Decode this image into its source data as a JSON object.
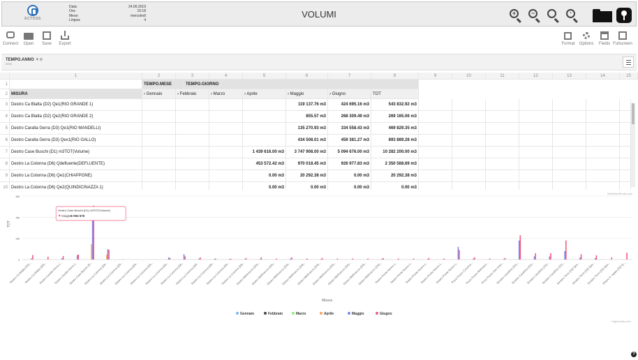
{
  "header": {
    "logo_text": "ECTOSS",
    "meta": [
      {
        "label": "Data:",
        "value": "24.06.2019"
      },
      {
        "label": "Ora:",
        "value": "10:18"
      },
      {
        "label": "Mese:",
        "value": "mercoledì"
      },
      {
        "label": "Lingua:",
        "value": "it"
      }
    ],
    "title": "VOLUMI"
  },
  "toolbar": {
    "left": [
      {
        "label": "Connect",
        "icon": "database-icon"
      },
      {
        "label": "Open",
        "icon": "folder-icon"
      },
      {
        "label": "Save",
        "icon": "save-icon"
      },
      {
        "label": "Export",
        "icon": "export-icon"
      }
    ],
    "right": [
      {
        "label": "Format",
        "icon": "edit-icon"
      },
      {
        "label": "Options",
        "icon": "gear-icon"
      },
      {
        "label": "Fields",
        "icon": "fields-icon"
      },
      {
        "label": "Fullscreen",
        "icon": "fullscreen-icon"
      }
    ]
  },
  "filter": {
    "chip_label": "TEMPO.ANNO",
    "chip_value": "2019"
  },
  "grid": {
    "col_headers": [
      "1",
      "2",
      "3",
      "4",
      "5",
      "6",
      "7",
      "8",
      "9",
      "10",
      "11",
      "12",
      "13",
      "14",
      "15"
    ],
    "dim_headers": [
      "TEMPO.MESE",
      "TEMPO.GIORNO"
    ],
    "row_header_label": "MISURA",
    "months": [
      "Gennaio",
      "Febbraio",
      "Marzo",
      "Aprile",
      "Maggio",
      "Giugno",
      "TOT"
    ],
    "rows": [
      {
        "n": "3",
        "name": "Destro Ca Blatta (D2) Qe1(RIO GRANDE 1)",
        "v": [
          "",
          "",
          "",
          "",
          "119 137.76 m3",
          "424 695.16 m3",
          "543 832.92 m3"
        ]
      },
      {
        "n": "4",
        "name": "Destro Ca Blatta (D2) Qe2(RIO GRANDE 2)",
        "v": [
          "",
          "",
          "",
          "",
          "855.57 m3",
          "268 309.49 m3",
          "269 165.06 m3"
        ]
      },
      {
        "n": "5",
        "name": "Destro Caralta Gerra (D3) Qe1(RIO MANDELLI)",
        "v": [
          "",
          "",
          "",
          "",
          "135 270.93 m3",
          "334 558.43 m3",
          "469 829.35 m3"
        ]
      },
      {
        "n": "6",
        "name": "Destro Caralta Gerra (D3) Qex1(RIO GALLO)",
        "v": [
          "",
          "",
          "",
          "",
          "434 508.01 m3",
          "459 381.27 m3",
          "893 889.28 m3"
        ]
      },
      {
        "n": "7",
        "name": "Destro Case Buschi (D1) m3TOT(Volume)",
        "v": [
          "",
          "",
          "",
          "1 439 616.00 m3",
          "3 747 908.00 m3",
          "5 094 676.00 m3",
          "10 282 200.00 m3"
        ]
      },
      {
        "n": "8",
        "name": "Destro La Colonna (D6) Qdefluente(DEFLUENTE)",
        "v": [
          "",
          "",
          "",
          "453 572.42 m3",
          "970 018.45 m3",
          "926 977.83 m3",
          "2 350 568.69 m3"
        ]
      },
      {
        "n": "9",
        "name": "Destro La Colonna (D6) Qe1(CHIAPPONE)",
        "v": [
          "",
          "",
          "",
          "0.00 m3",
          "20 292.38 m3",
          "0.00 m3",
          "20 292.38 m3"
        ]
      },
      {
        "n": "10",
        "name": "Destro La Colonna (D6) Qe2(QUINDICINAZZA 1)",
        "v": [
          "",
          "",
          "",
          "0.00 m3",
          "0.00 m3",
          "0.00 m3",
          "0.00 m3"
        ]
      }
    ],
    "credit": "WebDataRocks.com"
  },
  "chart_data": {
    "type": "bar",
    "ylabel": "TOT",
    "xlabel": "Misura",
    "y_ticks": [
      "6M",
      "4M",
      "2M",
      "0"
    ],
    "ylim": [
      0,
      6000000
    ],
    "categories": [
      "Destro Ca Blatta (D2)...",
      "Destro Ca Blatta (D2)...",
      "Destro Caralta Gerra (...",
      "Destro Caralta Gerra (...",
      "Destro Case Buschi (D...",
      "Destro La Colonna (D6...",
      "Destro La Colonna (D6...",
      "Destro La Colonna (D6...",
      "Destro La Colonna (D6...",
      "Destro La Colonna (D6...",
      "Destro La Colonna (D6...",
      "Destro La Colonna (D6...",
      "Destro La Colonna (D6...",
      "Destro La Colonna (D6...",
      "Destro La Colonna (D6...",
      "Destro Mellinaccio (D4)...",
      "Destro Mellinaccio (D4)...",
      "Destro Mellinaccio (D4)...",
      "Destro Mellinaccio (D4)...",
      "Destro Mellinaccio (D4)...",
      "Destro Mellinaccio (D4)...",
      "Destro Mellinaccio (D4)...",
      "Destro Mellinaccio (D4)...",
      "Destro Mellinaccio (D4)...",
      "Destro Ponte Nuovo (...",
      "Destro Ponte Nuovo (...",
      "Destro Ponte Nuovo (...",
      "Destro Ponte Nuovo (...",
      "Destro Ponte Nuovo (...",
      "Pozzi Pozzo Coriomo...",
      "Pozzi Pozzo Molinazzi...",
      "Pozzi Pozzo San Anto...",
      "Sinistro Cavalline (S1)...",
      "Sinistro Cavalline (S1)...",
      "Sinistro Cavalline (S1)...",
      "Sinistro Cavalline (S1)...",
      "Sinistro Torre (S3) Qe1...",
      "Sinistro Torre (S3) Qex...",
      "Sinistro Torre (S3) Qex...",
      "Villano S. Agata (S2) Q..."
    ],
    "series": [
      {
        "name": "Gennaio",
        "color": "#7cb5ec",
        "values": [
          0,
          0,
          0,
          0,
          0,
          0,
          0,
          0,
          0,
          0,
          0,
          0,
          0,
          0,
          0,
          0,
          0,
          0,
          0,
          0,
          0,
          0,
          0,
          0,
          0,
          0,
          0,
          0,
          0,
          0,
          0,
          0,
          0,
          0,
          0,
          0,
          0,
          0,
          0,
          0
        ]
      },
      {
        "name": "Febbraio",
        "color": "#434348",
        "values": [
          0,
          0,
          0,
          0,
          0,
          0,
          0,
          0,
          0,
          0,
          0,
          0,
          0,
          0,
          0,
          0,
          0,
          0,
          0,
          0,
          0,
          0,
          0,
          0,
          0,
          0,
          0,
          0,
          0,
          0,
          0,
          0,
          0,
          0,
          0,
          0,
          0,
          0,
          0,
          0
        ]
      },
      {
        "name": "Marzo",
        "color": "#90ed7d",
        "values": [
          0,
          0,
          0,
          0,
          0,
          0,
          0,
          0,
          0,
          0,
          0,
          0,
          0,
          0,
          0,
          0,
          0,
          0,
          0,
          0,
          0,
          0,
          0,
          0,
          0,
          0,
          0,
          0,
          0,
          0,
          0,
          0,
          0,
          0,
          0,
          0,
          0,
          0,
          0,
          0
        ]
      },
      {
        "name": "Aprile",
        "color": "#f7a35c",
        "values": [
          0,
          0,
          0,
          0,
          1439616,
          453572,
          0,
          0,
          0,
          0,
          0,
          0,
          0,
          0,
          0,
          0,
          0,
          0,
          0,
          0,
          0,
          0,
          0,
          0,
          0,
          0,
          0,
          0,
          0,
          0,
          0,
          0,
          0,
          0,
          0,
          0,
          0,
          0,
          0,
          0
        ]
      },
      {
        "name": "Maggio",
        "color": "#8085e9",
        "values": [
          119138,
          856,
          135271,
          434508,
          3747908,
          970018,
          20292,
          0,
          0,
          200000,
          500000,
          100000,
          50000,
          60000,
          40000,
          50000,
          0,
          100000,
          0,
          50000,
          0,
          0,
          0,
          60000,
          0,
          0,
          50000,
          0,
          1200000,
          100000,
          0,
          50000,
          1800000,
          300000,
          300000,
          800000,
          200000,
          150000,
          0,
          0
        ]
      },
      {
        "name": "Giugno",
        "color": "#f15c80",
        "values": [
          424695,
          268309,
          334558,
          459381,
          5094676,
          926978,
          0,
          0,
          0,
          150000,
          300000,
          200000,
          100000,
          80000,
          150000,
          200000,
          100000,
          200000,
          100000,
          150000,
          100000,
          100000,
          100000,
          150000,
          100000,
          100000,
          150000,
          100000,
          900000,
          200000,
          100000,
          150000,
          2300000,
          600000,
          600000,
          1800000,
          500000,
          400000,
          200000,
          650000
        ]
      }
    ],
    "tooltip": {
      "title": "Destro Case Buschi (D1) m3TOT(Volume)",
      "series": "Giugno",
      "value": "5 094 676"
    },
    "credit": "Highcharts.com"
  }
}
